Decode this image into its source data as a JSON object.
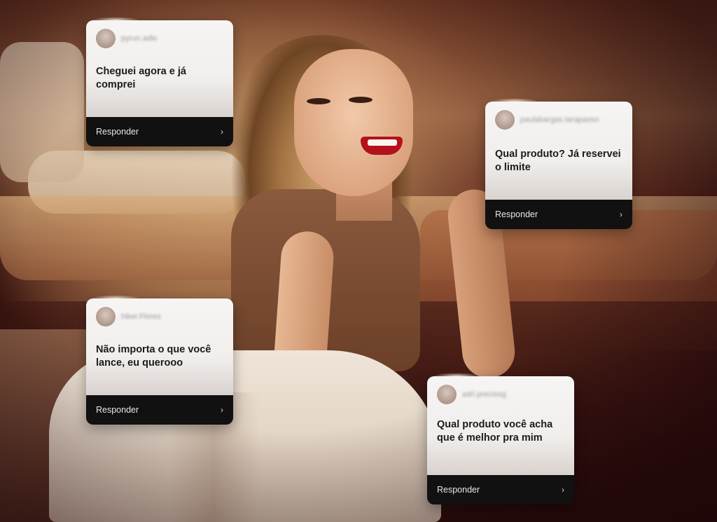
{
  "scene": {
    "colors": {
      "card_bg": "#f3f1ef",
      "card_footer": "#111111",
      "lip_red": "#b3111b"
    }
  },
  "comments": [
    {
      "username": "pyrun.adle",
      "text": "Cheguei agora e já comprei",
      "reply_label": "Responder",
      "chevron": "›"
    },
    {
      "username": "paulabargas.tarapaoso",
      "text": "Qual produto? Já reservei o limite",
      "reply_label": "Responder",
      "chevron": "›"
    },
    {
      "username": "hiker.Flores",
      "text": "Não importa o que você lance, eu querooo",
      "reply_label": "Responder",
      "chevron": "›"
    },
    {
      "username": "adri.preciosg",
      "text": "Qual produto você acha que é melhor pra mim",
      "reply_label": "Responder",
      "chevron": "›"
    }
  ]
}
